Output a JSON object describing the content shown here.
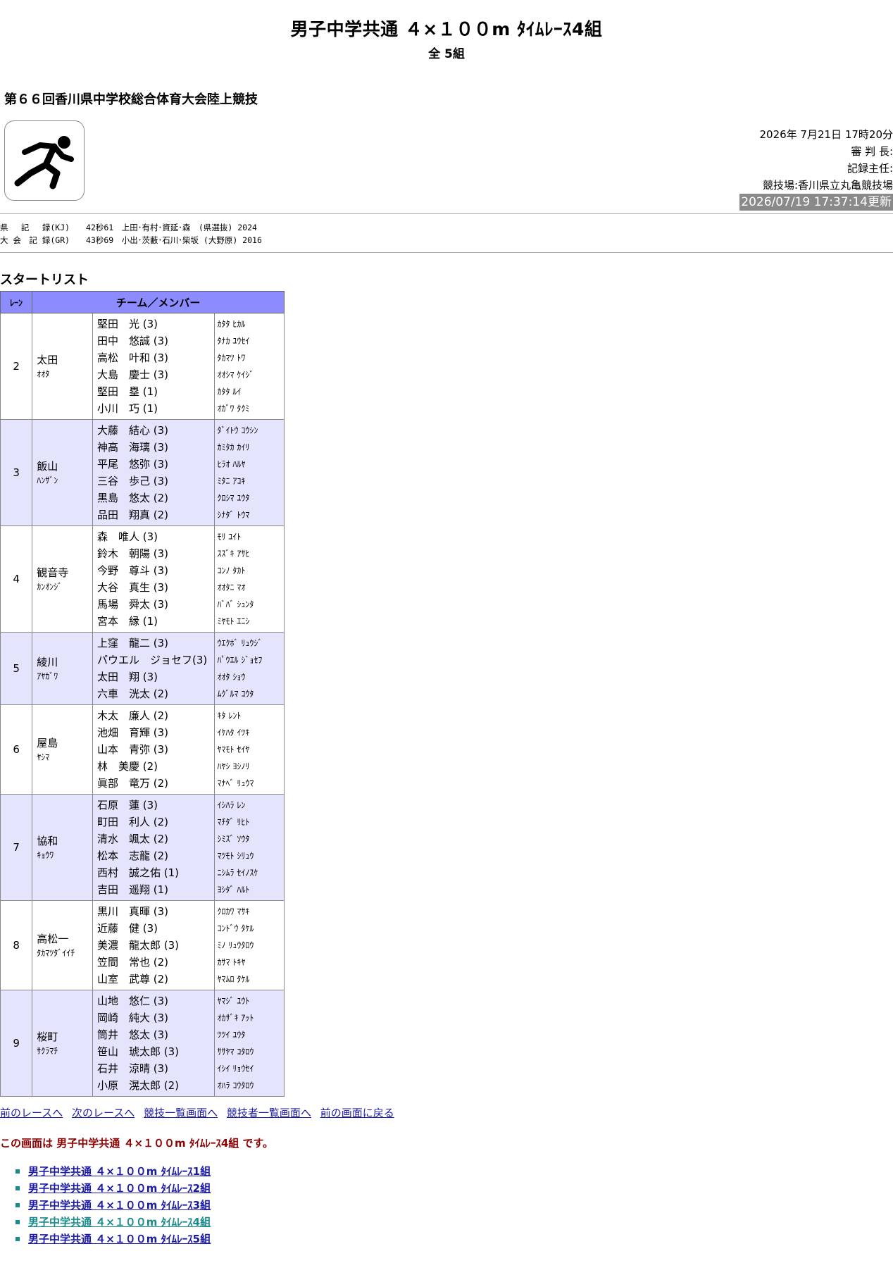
{
  "header": {
    "title": "男子中学共通 ４×１００m ﾀｲﾑﾚｰｽ4組",
    "subtitle": "全 5組",
    "meet_name": "第６６回香川県中学校総合体育大会陸上競技"
  },
  "meta": {
    "datetime": "2026年 7月21日 17時20分",
    "referee": "審 判 長:",
    "recorder": "記録主任:",
    "venue": "競技場:香川県立丸亀競技場",
    "updated": "2026/07/19 17:37:14更新"
  },
  "records": {
    "kj": "県　 記　 録(KJ)　　42秒61　上田･有村･資延･森　(県選抜) 2024",
    "gr": "大 会　記 録(GR)　　43秒69　小出･茨藪･石川･柴坂 (大野原) 2016"
  },
  "start_list": {
    "title": "スタートリスト",
    "col_lane": "ﾚｰﾝ",
    "col_team": "チーム／メンバー",
    "teams": [
      {
        "lane": "2",
        "name": "太田",
        "kana": "ｵｵﾀ",
        "members": [
          "堅田　光 (3)",
          "田中　悠誠 (3)",
          "高松　叶和 (3)",
          "大島　慶士 (3)",
          "堅田　塁 (1)",
          "小川　巧 (1)"
        ],
        "members_kana": [
          "ｶﾀﾀ ﾋｶﾙ",
          "ﾀﾅｶ ﾕｳｾｲ",
          "ﾀｶﾏﾂ ﾄﾜ",
          "ｵｵｼﾏ ｹｲｼﾞ",
          "ｶﾀﾀ ﾙｲ",
          "ｵｶﾞﾜ ﾀｸﾐ"
        ]
      },
      {
        "lane": "3",
        "name": "飯山",
        "kana": "ﾊﾝｻﾞﾝ",
        "members": [
          "大藤　結心 (3)",
          "神高　海璃 (3)",
          "平尾　悠弥 (3)",
          "三谷　歩己 (3)",
          "黒島　悠太 (2)",
          "品田　翔真 (2)"
        ],
        "members_kana": [
          "ﾀﾞｲﾄｳ ｺｳｼﾝ",
          "ｶﾐﾀｶ ｶｲﾘ",
          "ﾋﾗｵ ﾊﾙﾔ",
          "ﾐﾀﾆ ｱｺｷ",
          "ｸﾛｼﾏ ﾕｳﾀ",
          "ｼﾅﾀﾞ ﾄｳﾏ"
        ]
      },
      {
        "lane": "4",
        "name": "観音寺",
        "kana": "ｶﾝｵﾝｼﾞ",
        "members": [
          "森　唯人 (3)",
          "鈴木　朝陽 (3)",
          "今野　尊斗 (3)",
          "大谷　真生 (3)",
          "馬場　舜太 (3)",
          "宮本　縁 (1)"
        ],
        "members_kana": [
          "ﾓﾘ ﾕｲﾄ",
          "ｽｽﾞｷ ｱｻﾋ",
          "ｺﾝﾉ ﾀｶﾄ",
          "ｵｵﾀﾆ ﾏｵ",
          "ﾊﾞﾊﾞ ｼｭﾝﾀ",
          "ﾐﾔﾓﾄ ｴﾆｼ"
        ]
      },
      {
        "lane": "5",
        "name": "綾川",
        "kana": "ｱﾔｶﾞﾜ",
        "members": [
          "上窪　龍二 (3)",
          "パウエル　ジョセフ(3)",
          "太田　翔 (3)",
          "六車　洸太 (2)"
        ],
        "members_kana": [
          "ｳｴｸﾎﾞ ﾘｭｳｼﾞ",
          "ﾊﾟｳｴﾙ ｼﾞｮｾﾌ",
          "ｵｵﾀ ｼｮｳ",
          "ﾑｸﾞﾙﾏ ｺｳﾀ"
        ]
      },
      {
        "lane": "6",
        "name": "屋島",
        "kana": "ﾔｼﾏ",
        "members": [
          "木太　廉人 (2)",
          "池畑　育輝 (3)",
          "山本　青弥 (3)",
          "林　美慶 (2)",
          "眞部　竜万 (2)"
        ],
        "members_kana": [
          "ｷﾀ ﾚﾝﾄ",
          "ｲｹﾊﾀ ｲﾂｷ",
          "ﾔﾏﾓﾄ ｾｲﾔ",
          "ﾊﾔｼ ﾖｼﾉﾘ",
          "ﾏﾅﾍﾞ ﾘｭｳﾏ"
        ]
      },
      {
        "lane": "7",
        "name": "協和",
        "kana": "ｷｮｳﾜ",
        "members": [
          "石原　蓮 (3)",
          "町田　利人 (2)",
          "清水　颯太 (2)",
          "松本　志龍 (2)",
          "西村　誠之佑 (1)",
          "吉田　遥翔 (1)"
        ],
        "members_kana": [
          "ｲｼﾊﾗ ﾚﾝ",
          "ﾏﾁﾀﾞ ﾘﾋﾄ",
          "ｼﾐｽﾞ ｿｳﾀ",
          "ﾏﾂﾓﾄ ｼﾘｭｳ",
          "ﾆｼﾑﾗ ｾｲﾉｽｹ",
          "ﾖｼﾀﾞ ﾊﾙﾄ"
        ]
      },
      {
        "lane": "8",
        "name": "高松一",
        "kana": "ﾀｶﾏﾂﾀﾞｲｲﾁ",
        "members": [
          "黒川　真暉 (3)",
          "近藤　健 (3)",
          "美濃　龍太郎 (3)",
          "笠間　常也 (2)",
          "山室　武尊 (2)"
        ],
        "members_kana": [
          "ｸﾛｶﾜ ﾏｻｷ",
          "ｺﾝﾄﾞｳ ﾀｹﾙ",
          "ﾐﾉ ﾘｭｳﾀﾛｳ",
          "ｶｻﾏ ﾄｷﾔ",
          "ﾔﾏﾑﾛ ﾀｹﾙ"
        ]
      },
      {
        "lane": "9",
        "name": "桜町",
        "kana": "ｻｸﾗﾏﾁ",
        "members": [
          "山地　悠仁 (3)",
          "岡崎　純大 (3)",
          "筒井　悠太 (3)",
          "笹山　琥太郎 (3)",
          "石井　涼晴 (3)",
          "小原　滉太郎 (2)"
        ],
        "members_kana": [
          "ﾔﾏｼﾞ ﾕｳﾄ",
          "ｵｶｻﾞｷ ｱｯﾄ",
          "ﾂﾂｲ ﾕｳﾀ",
          "ｻｻﾔﾏ ｺﾀﾛｳ",
          "ｲｼｲ ﾘｮｳｾｲ",
          "ｵﾊﾗ ｺｳﾀﾛｳ"
        ]
      }
    ]
  },
  "nav": {
    "prev_race": "前のレースへ",
    "next_race": "次のレースへ",
    "event_list": "競技一覧画面へ",
    "athlete_list": "競技者一覧画面へ",
    "back": "前の画面に戻る"
  },
  "current_note": "この画面は 男子中学共通 ４×１００m ﾀｲﾑﾚｰｽ4組 です。",
  "race_links": [
    "男子中学共通 ４×１００m ﾀｲﾑﾚｰｽ1組",
    "男子中学共通 ４×１００m ﾀｲﾑﾚｰｽ2組",
    "男子中学共通 ４×１００m ﾀｲﾑﾚｰｽ3組",
    "男子中学共通 ４×１００m ﾀｲﾑﾚｰｽ4組",
    "男子中学共通 ４×１００m ﾀｲﾑﾚｰｽ5組"
  ],
  "current_race_index": 3,
  "logo_icon": "running-man-icon"
}
